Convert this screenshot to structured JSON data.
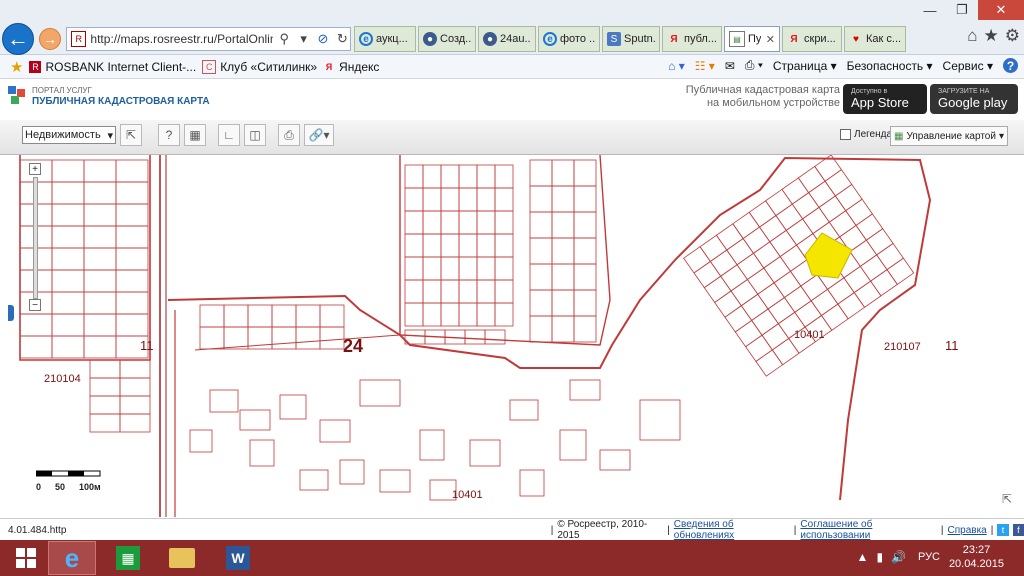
{
  "browser": {
    "url_prefix": "http://",
    "url_rest": "maps.rosreestr.ru/PortalOnline...",
    "url_domain": "rosreestr.ru",
    "tabs": [
      {
        "icon": "ie",
        "label": "аукц...",
        "closable": false
      },
      {
        "icon": "ok",
        "label": "Созд...",
        "closable": false
      },
      {
        "icon": "ok",
        "label": "24au...",
        "closable": false
      },
      {
        "icon": "ie",
        "label": "фото ...",
        "closable": false
      },
      {
        "icon": "sp",
        "label": "Sputn...",
        "closable": false
      },
      {
        "icon": "ya",
        "label": "публ...",
        "closable": false
      },
      {
        "icon": "doc",
        "label": "Пу...",
        "closable": true
      },
      {
        "icon": "ya",
        "label": "скри...",
        "closable": false
      },
      {
        "icon": "hrt",
        "label": "Как с...",
        "closable": false
      }
    ]
  },
  "favorites": {
    "items": [
      {
        "icon": "rosbank",
        "label": "ROSBANK Internet Client-..."
      },
      {
        "icon": "citilink",
        "label": "Клуб «Ситилинк»"
      },
      {
        "icon": "yandex",
        "label": "Яндекс"
      }
    ]
  },
  "commandbar": {
    "page": "Страница",
    "security": "Безопасность",
    "service": "Сервис"
  },
  "portal": {
    "logo_top": "ПОРТАЛ УСЛУГ",
    "logo_title": "ПУБЛИЧНАЯ КАДАСТРОВАЯ КАРТА",
    "mobile_line1": "Публичная кадастровая карта",
    "mobile_line2": "на мобильном устройстве",
    "appstore_small": "Доступно в",
    "appstore_big": "App Store",
    "gplay_small": "ЗАГРУЗИТЕ НА",
    "gplay_big": "Google play"
  },
  "toolbar": {
    "property_type": "Недвижимость",
    "legend_label": "Легенда",
    "map_control_label": "Управление картой"
  },
  "map": {
    "district_labels": [
      "11",
      "24",
      "11"
    ],
    "block_labels": [
      "210104",
      "10401",
      "210107",
      "10401"
    ],
    "scale_labels": [
      "0",
      "50",
      "100м"
    ],
    "highlight_color": "#f5e600",
    "line_color": "#c03a3a"
  },
  "status": {
    "left": "4.01.484.http",
    "copyright": "© Росреестр, 2010-2015",
    "link_updates": "Сведения об обновлениях",
    "link_terms": "Соглашение об использовании",
    "link_help": "Справка"
  },
  "taskbar": {
    "lang": "РУС",
    "time": "23:27",
    "date": "20.04.2015"
  }
}
